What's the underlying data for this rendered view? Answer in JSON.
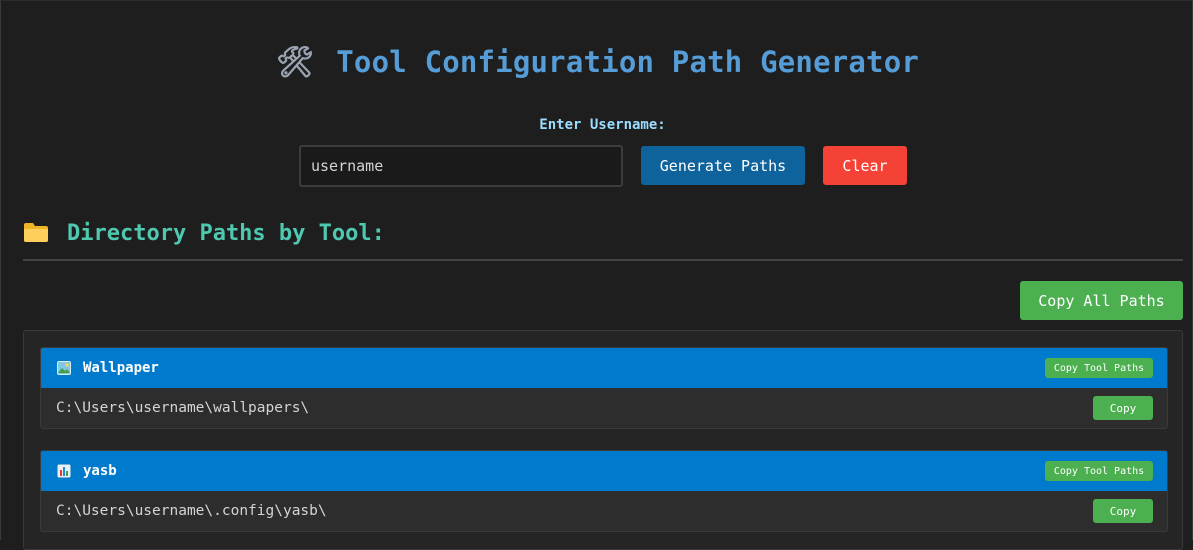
{
  "header": {
    "title_icon": "hammer-wrench-icon",
    "title": "Tool Configuration Path Generator"
  },
  "form": {
    "label": "Enter Username:",
    "username_value": "username",
    "generate_label": "Generate Paths",
    "clear_label": "Clear"
  },
  "section": {
    "icon": "folder-icon",
    "title": "Directory Paths by Tool:",
    "copy_all_label": "Copy All Paths"
  },
  "tools": [
    {
      "icon": "picture-icon",
      "name": "Wallpaper",
      "copy_tool_label": "Copy Tool Paths",
      "path": "C:\\Users\\username\\wallpapers\\",
      "copy_label": "Copy"
    },
    {
      "icon": "bar-chart-icon",
      "name": "yasb",
      "copy_tool_label": "Copy Tool Paths",
      "path": "C:\\Users\\username\\.config\\yasb\\",
      "copy_label": "Copy"
    }
  ],
  "colors": {
    "background": "#1e1e1e",
    "title": "#569cd6",
    "label": "#9cdcfe",
    "section_title": "#4ec9b0",
    "header_blue": "#007acc",
    "primary_button": "#0e639c",
    "danger_button": "#f44336",
    "success_button": "#4caf50"
  }
}
